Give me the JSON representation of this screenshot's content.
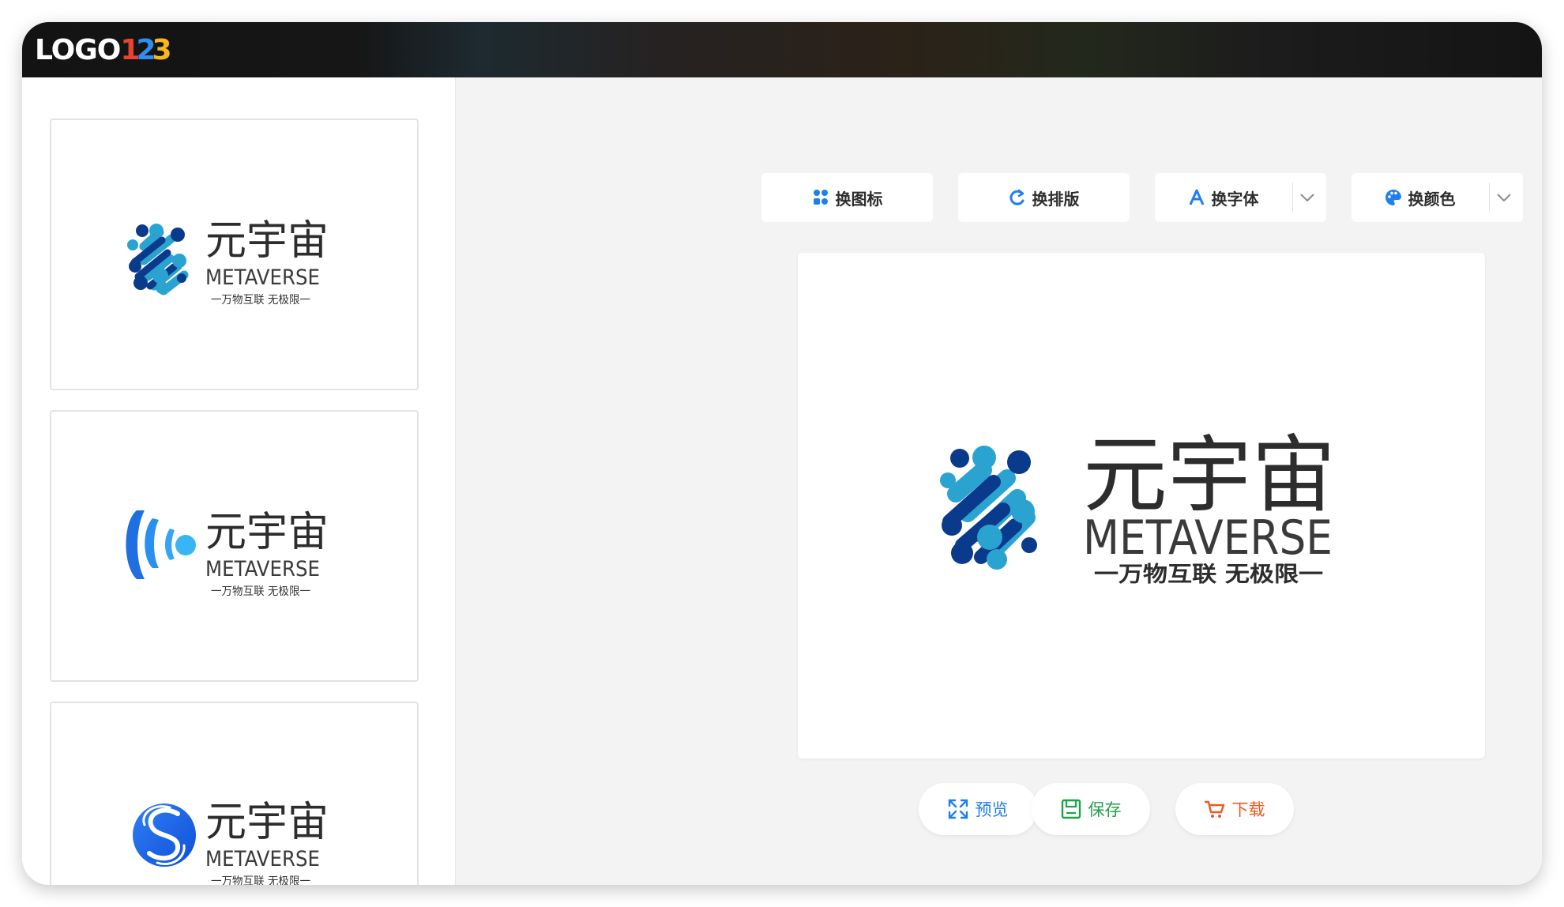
{
  "app": {
    "brand_word": "LOGO",
    "brand_digit_1": "1",
    "brand_digit_2": "2",
    "brand_digit_3": "3"
  },
  "logo_text": {
    "title": "元宇宙",
    "subtitle": "METAVERSE",
    "slogan": "一万物互联 无极限一"
  },
  "thumbnails": [
    {
      "icon": "blob-network-icon",
      "title": "元宇宙",
      "subtitle": "METAVERSE",
      "slogan": "一万物互联 无极限一"
    },
    {
      "icon": "signal-wave-icon",
      "title": "元宇宙",
      "subtitle": "METAVERSE",
      "slogan": "一万物互联 无极限一"
    },
    {
      "icon": "s-circle-icon",
      "title": "元宇宙",
      "subtitle": "METAVERSE",
      "slogan": "一万物互联 无极限一"
    }
  ],
  "toolbar": {
    "change_icon": "换图标",
    "change_layout": "换排版",
    "change_font": "换字体",
    "change_color": "换颜色"
  },
  "actions": {
    "preview": "预览",
    "save": "保存",
    "download": "下载"
  },
  "colors": {
    "dark_blue": "#0a3a8c",
    "light_blue": "#2aa3d1",
    "accent_blue": "#1f7ff0",
    "save_green": "#1ea34a",
    "download_orange": "#ee5a22"
  }
}
